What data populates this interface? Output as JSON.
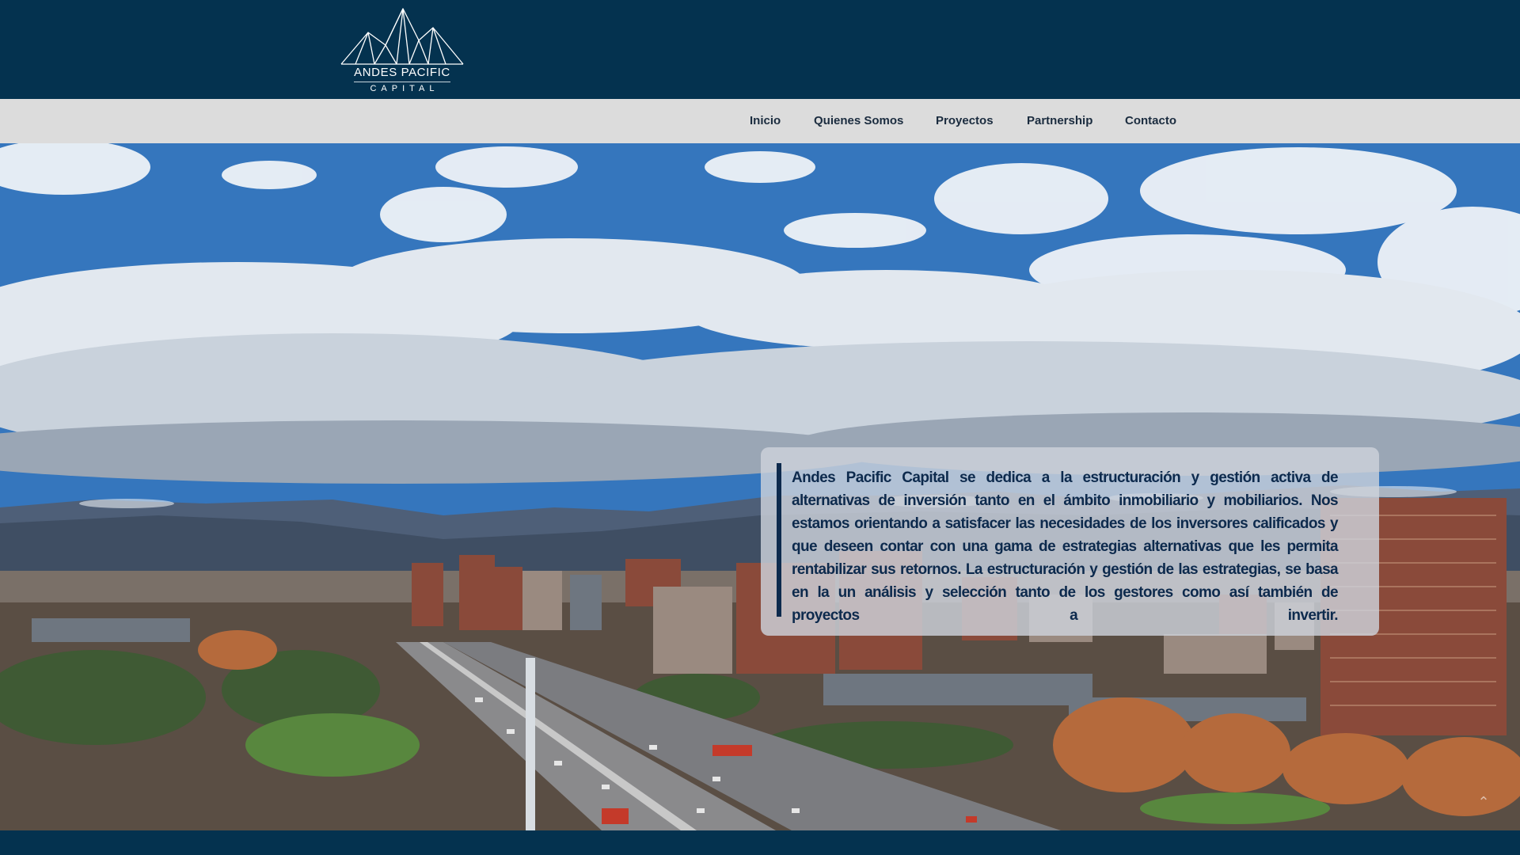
{
  "header": {
    "logo": {
      "line1": "ANDES PACIFIC",
      "line2": "CAPITAL",
      "icon": "mountain-icon"
    }
  },
  "nav": {
    "items": [
      {
        "label": "Inicio"
      },
      {
        "label": "Quienes Somos"
      },
      {
        "label": "Proyectos"
      },
      {
        "label": "Partnership"
      },
      {
        "label": "Contacto"
      }
    ]
  },
  "hero": {
    "image": "santiago-city-skyline-with-andes-mountains",
    "description": "Andes Pacific Capital se dedica a la estructuración y gestión activa de alternativas de inversión tanto en el ámbito inmobiliario y mobiliarios. Nos estamos orientando a satisfacer las necesidades de los inversores calificados y que deseen contar con una gama de estrategias alternativas que les permita rentabilizar sus retornos. La estructuración y gestión de las estrategias, se basa en la un análisis y selección tanto de los gestores como así también de proyectos a invertir.",
    "scroll_icon": "chevron-up-icon"
  },
  "colors": {
    "header_bg": "#04324f",
    "nav_bg": "#dcdcdc",
    "nav_text": "#1b2c3f",
    "card_text": "#0d2a4d"
  }
}
